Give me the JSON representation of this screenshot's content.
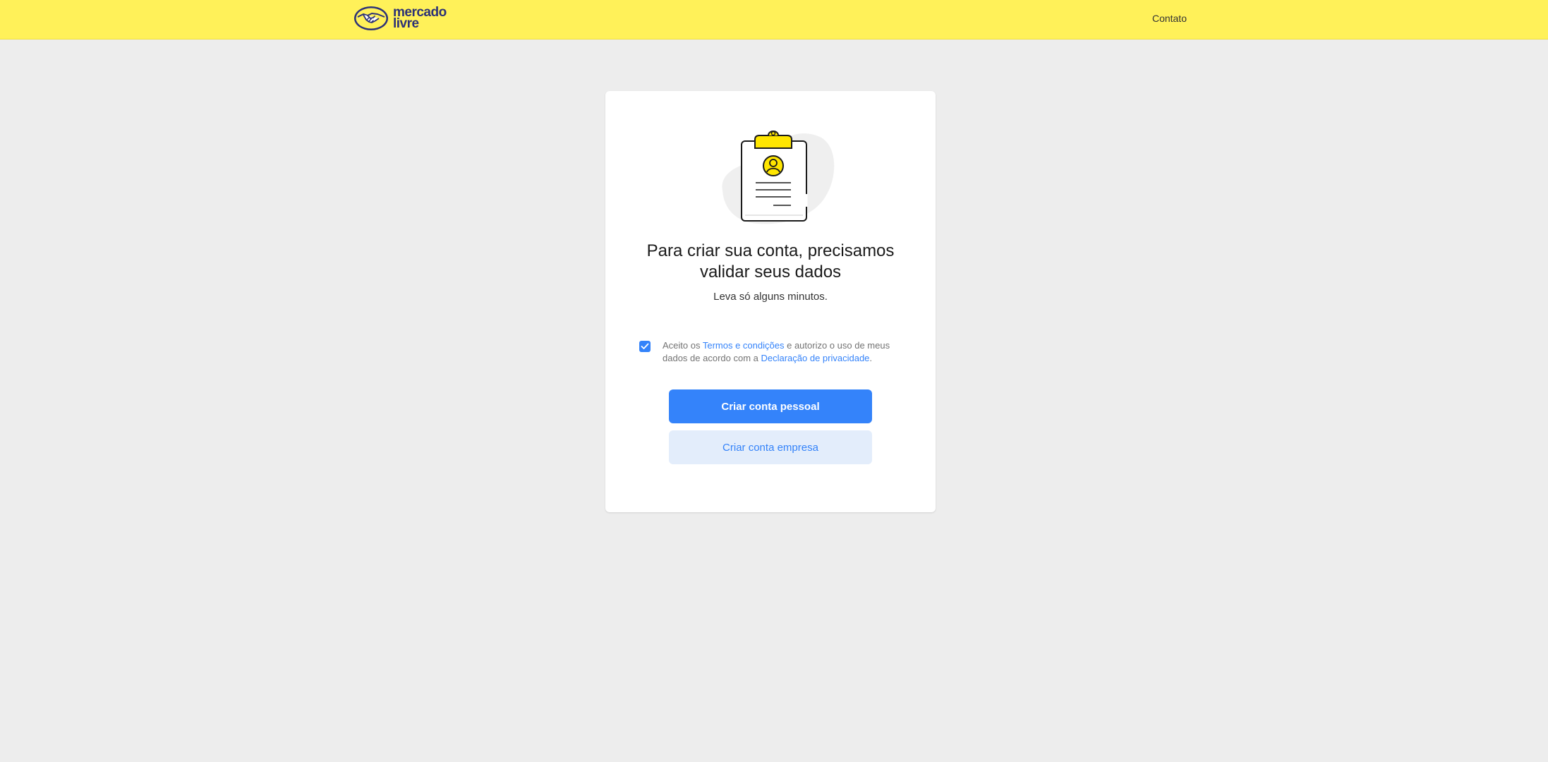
{
  "header": {
    "logo_line1": "mercado",
    "logo_line2": "livre",
    "contact_label": "Contato",
    "background_color": "#fff159",
    "logo_color": "#2d3277"
  },
  "card": {
    "illustration": "clipboard-user-icon",
    "title": "Para criar sua conta, precisamos validar seus dados",
    "subtitle": "Leva só alguns minutos.",
    "terms": {
      "checked": true,
      "prefix": "Aceito os ",
      "terms_link": "Termos e condições",
      "middle": " e autorizo o uso de meus dados de acordo com a ",
      "privacy_link": "Declaração de privacidade",
      "suffix": "."
    },
    "primary_button": "Criar conta pessoal",
    "secondary_button": "Criar conta empresa"
  },
  "colors": {
    "accent": "#3483fa",
    "page_background": "#ededed",
    "secondary_button_bg": "#e3edfb"
  }
}
